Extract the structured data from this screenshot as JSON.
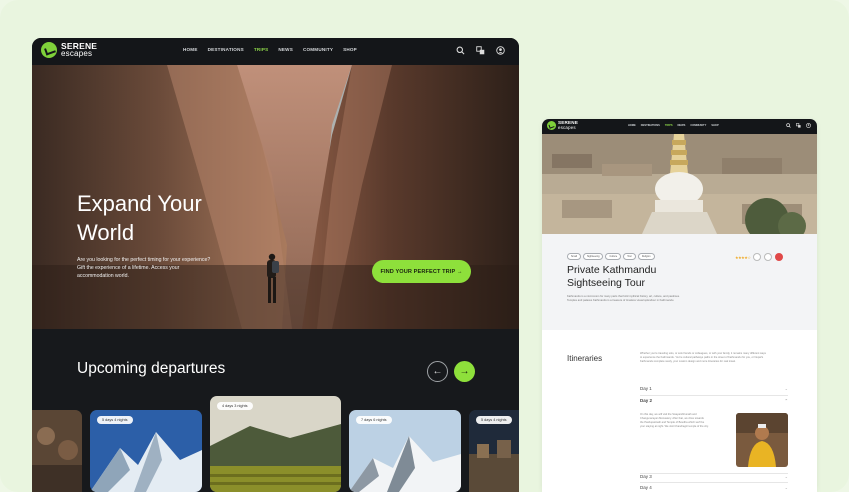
{
  "brand": {
    "name_top": "SERENE",
    "name_bottom": "escapes"
  },
  "nav": {
    "items": [
      "HOME",
      "DESTINATIONS",
      "TRIPS",
      "NEWS",
      "COMMUNITY",
      "SHOP"
    ],
    "active": "TRIPS"
  },
  "hero": {
    "title_line1": "Expand Your",
    "title_line2": "World",
    "desc_line1": "Are you looking for the perfect timing for your experience?",
    "desc_line2": "Gift the experience of a lifetime. Access your",
    "desc_line3": "accommodation world.",
    "cta": "FIND YOUR PERFECT TRIP →"
  },
  "upcoming": {
    "heading": "Upcoming departures",
    "prev_icon": "arrow-left-icon",
    "next_icon": "arrow-right-icon",
    "cards": [
      {
        "badge": ""
      },
      {
        "badge": "5 days 4 nights"
      },
      {
        "badge": "4 days 3 nights"
      },
      {
        "badge": "7 days 6 nights"
      },
      {
        "badge": "5 days 4 nights"
      }
    ]
  },
  "detail": {
    "tags": [
      "Small",
      "Sightseeing",
      "Culture",
      "Tour",
      "Religion"
    ],
    "title_line1": "Private Kathmandu",
    "title_line2": "Sightseeing Tour",
    "desc_line1": "Kathmandu is a microcosm for many parts that hold mythical history, art, culture, and pastimes.",
    "desc_line2": "Temples and palaces Kathmandu is a treasure of timeless visual splendour in Kathmandu.",
    "itineraries_label": "Itineraries",
    "itin_desc_line1": "Whether you're traveling solo, or solo friends or colleagues, or with your family, it remains many different ways",
    "itin_desc_line2": "to experience the Kathmandu. You're cultural pathways paths in the street of Kathmandu for you, or Nepal's",
    "itin_desc_line3": "Kathmandu complete newly, your custom design and more itineraries for real travel.",
    "days": [
      "Day 1",
      "Day 2",
      "Day 3",
      "Day 4"
    ],
    "day2_text_line1": "On this day, we will visit the Swayambhunath and",
    "day2_text_line2": "Changunarayan Monastery. After that, we drive towards",
    "day2_text_line3": "the Pashupatinath and Temple of Boudha which we'll be",
    "day2_text_line4": "your staying at night. We visit Chandragiri temple of the city."
  },
  "colors": {
    "accent": "#8ee03b",
    "dark": "#17191c",
    "background": "#e9f5df"
  }
}
